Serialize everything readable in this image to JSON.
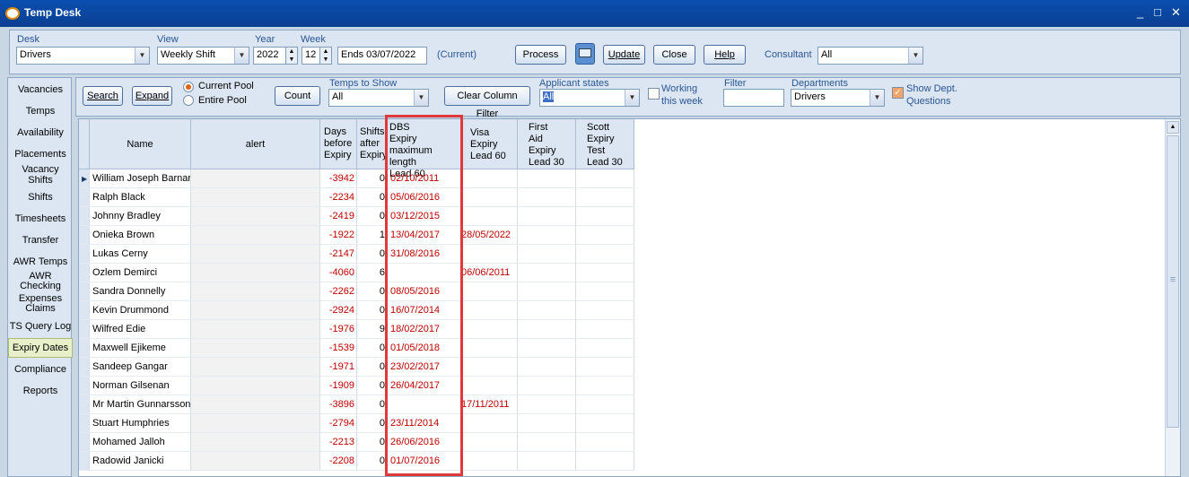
{
  "window": {
    "title": "Temp Desk",
    "controls": [
      "_",
      "□",
      "✕"
    ]
  },
  "top_bar": {
    "desk_label": "Desk",
    "desk_value": "Drivers",
    "view_label": "View",
    "view_value": "Weekly Shift",
    "year_label": "Year",
    "year_value": "2022",
    "week_label": "Week",
    "week_value": "12",
    "ends_value": "Ends 03/07/2022",
    "current_text": "(Current)",
    "process_label": "Process",
    "update_label": "Update",
    "close_label": "Close",
    "help_label": "Help",
    "consultant_label": "Consultant",
    "consultant_value": "All"
  },
  "sidebar": {
    "items": [
      {
        "label": "Vacancies"
      },
      {
        "label": "Temps"
      },
      {
        "label": "Availability"
      },
      {
        "label": "Placements"
      },
      {
        "label": "Vacancy Shifts"
      },
      {
        "label": "Shifts"
      },
      {
        "label": "Timesheets"
      },
      {
        "label": "Transfer"
      },
      {
        "label": "AWR Temps"
      },
      {
        "label": "AWR Checking"
      },
      {
        "label": "Expenses Claims"
      },
      {
        "label": "TS Query Log"
      },
      {
        "label": "Expiry Dates"
      },
      {
        "label": "Compliance"
      },
      {
        "label": "Reports"
      }
    ],
    "selected": "Expiry Dates"
  },
  "filters": {
    "search_label": "Search",
    "expand_label": "Expand",
    "current_pool_label": "Current Pool",
    "entire_pool_label": "Entire Pool",
    "count_label": "Count",
    "temps_to_show_label": "Temps to Show",
    "temps_to_show_value": "All",
    "clear_filter_label": "Clear Column Filter",
    "applicant_states_label": "Applicant states",
    "applicant_states_value": "All",
    "working_label_1": "Working",
    "working_label_2": "this week",
    "filter_label": "Filter",
    "filter_value": "",
    "departments_label": "Departments",
    "departments_value": "Drivers",
    "show_dept_label_1": "Show Dept.",
    "show_dept_label_2": "Questions"
  },
  "table": {
    "headers": {
      "name": "Name",
      "alert": "alert",
      "days": [
        "Days",
        "before",
        "Expiry"
      ],
      "shifts": [
        "Shifts",
        "after",
        "Expiry"
      ],
      "dbs": [
        "DBS",
        "Expiry",
        "maximum length",
        "Lead 60"
      ],
      "visa": [
        "Visa",
        "Expiry",
        "Lead 60"
      ],
      "firstaid": [
        "First",
        "Aid",
        "Expiry",
        "Lead 30"
      ],
      "scott": [
        "Scott",
        "Expiry",
        "Test",
        "Lead 30"
      ]
    },
    "rows": [
      {
        "name": "William Joseph Barnard",
        "days": "-3942",
        "shifts": "0",
        "dbs": "02/10/2011",
        "visa": ""
      },
      {
        "name": "Ralph Black",
        "days": "-2234",
        "shifts": "0",
        "dbs": "05/06/2016",
        "visa": ""
      },
      {
        "name": "Johnny Bradley",
        "days": "-2419",
        "shifts": "0",
        "dbs": "03/12/2015",
        "visa": ""
      },
      {
        "name": "Onieka Brown",
        "days": "-1922",
        "shifts": "1",
        "dbs": "13/04/2017",
        "visa": "28/05/2022"
      },
      {
        "name": "Lukas Cerny",
        "days": "-2147",
        "shifts": "0",
        "dbs": "31/08/2016",
        "visa": ""
      },
      {
        "name": "Ozlem Demirci",
        "days": "-4060",
        "shifts": "6",
        "dbs": "",
        "visa": "06/06/2011"
      },
      {
        "name": "Sandra Donnelly",
        "days": "-2262",
        "shifts": "0",
        "dbs": "08/05/2016",
        "visa": ""
      },
      {
        "name": "Kevin Drummond",
        "days": "-2924",
        "shifts": "0",
        "dbs": "16/07/2014",
        "visa": ""
      },
      {
        "name": "Wilfred Edie",
        "days": "-1976",
        "shifts": "9",
        "dbs": "18/02/2017",
        "visa": ""
      },
      {
        "name": "Maxwell Ejikeme",
        "days": "-1539",
        "shifts": "0",
        "dbs": "01/05/2018",
        "visa": ""
      },
      {
        "name": "Sandeep Gangar",
        "days": "-1971",
        "shifts": "0",
        "dbs": "23/02/2017",
        "visa": ""
      },
      {
        "name": "Norman Gilsenan",
        "days": "-1909",
        "shifts": "0",
        "dbs": "26/04/2017",
        "visa": ""
      },
      {
        "name": "Mr Martin Gunnarsson",
        "days": "-3896",
        "shifts": "0",
        "dbs": "",
        "visa": "17/11/2011"
      },
      {
        "name": "Stuart Humphries",
        "days": "-2794",
        "shifts": "0",
        "dbs": "23/11/2014",
        "visa": ""
      },
      {
        "name": "Mohamed Jalloh",
        "days": "-2213",
        "shifts": "0",
        "dbs": "26/06/2016",
        "visa": ""
      },
      {
        "name": "Radowid Janicki",
        "days": "-2208",
        "shifts": "0",
        "dbs": "01/07/2016",
        "visa": ""
      }
    ]
  },
  "colors": {
    "highlight": "#e0393b",
    "expired_text": "#c00000",
    "title_bar": "#0a4fb0"
  }
}
